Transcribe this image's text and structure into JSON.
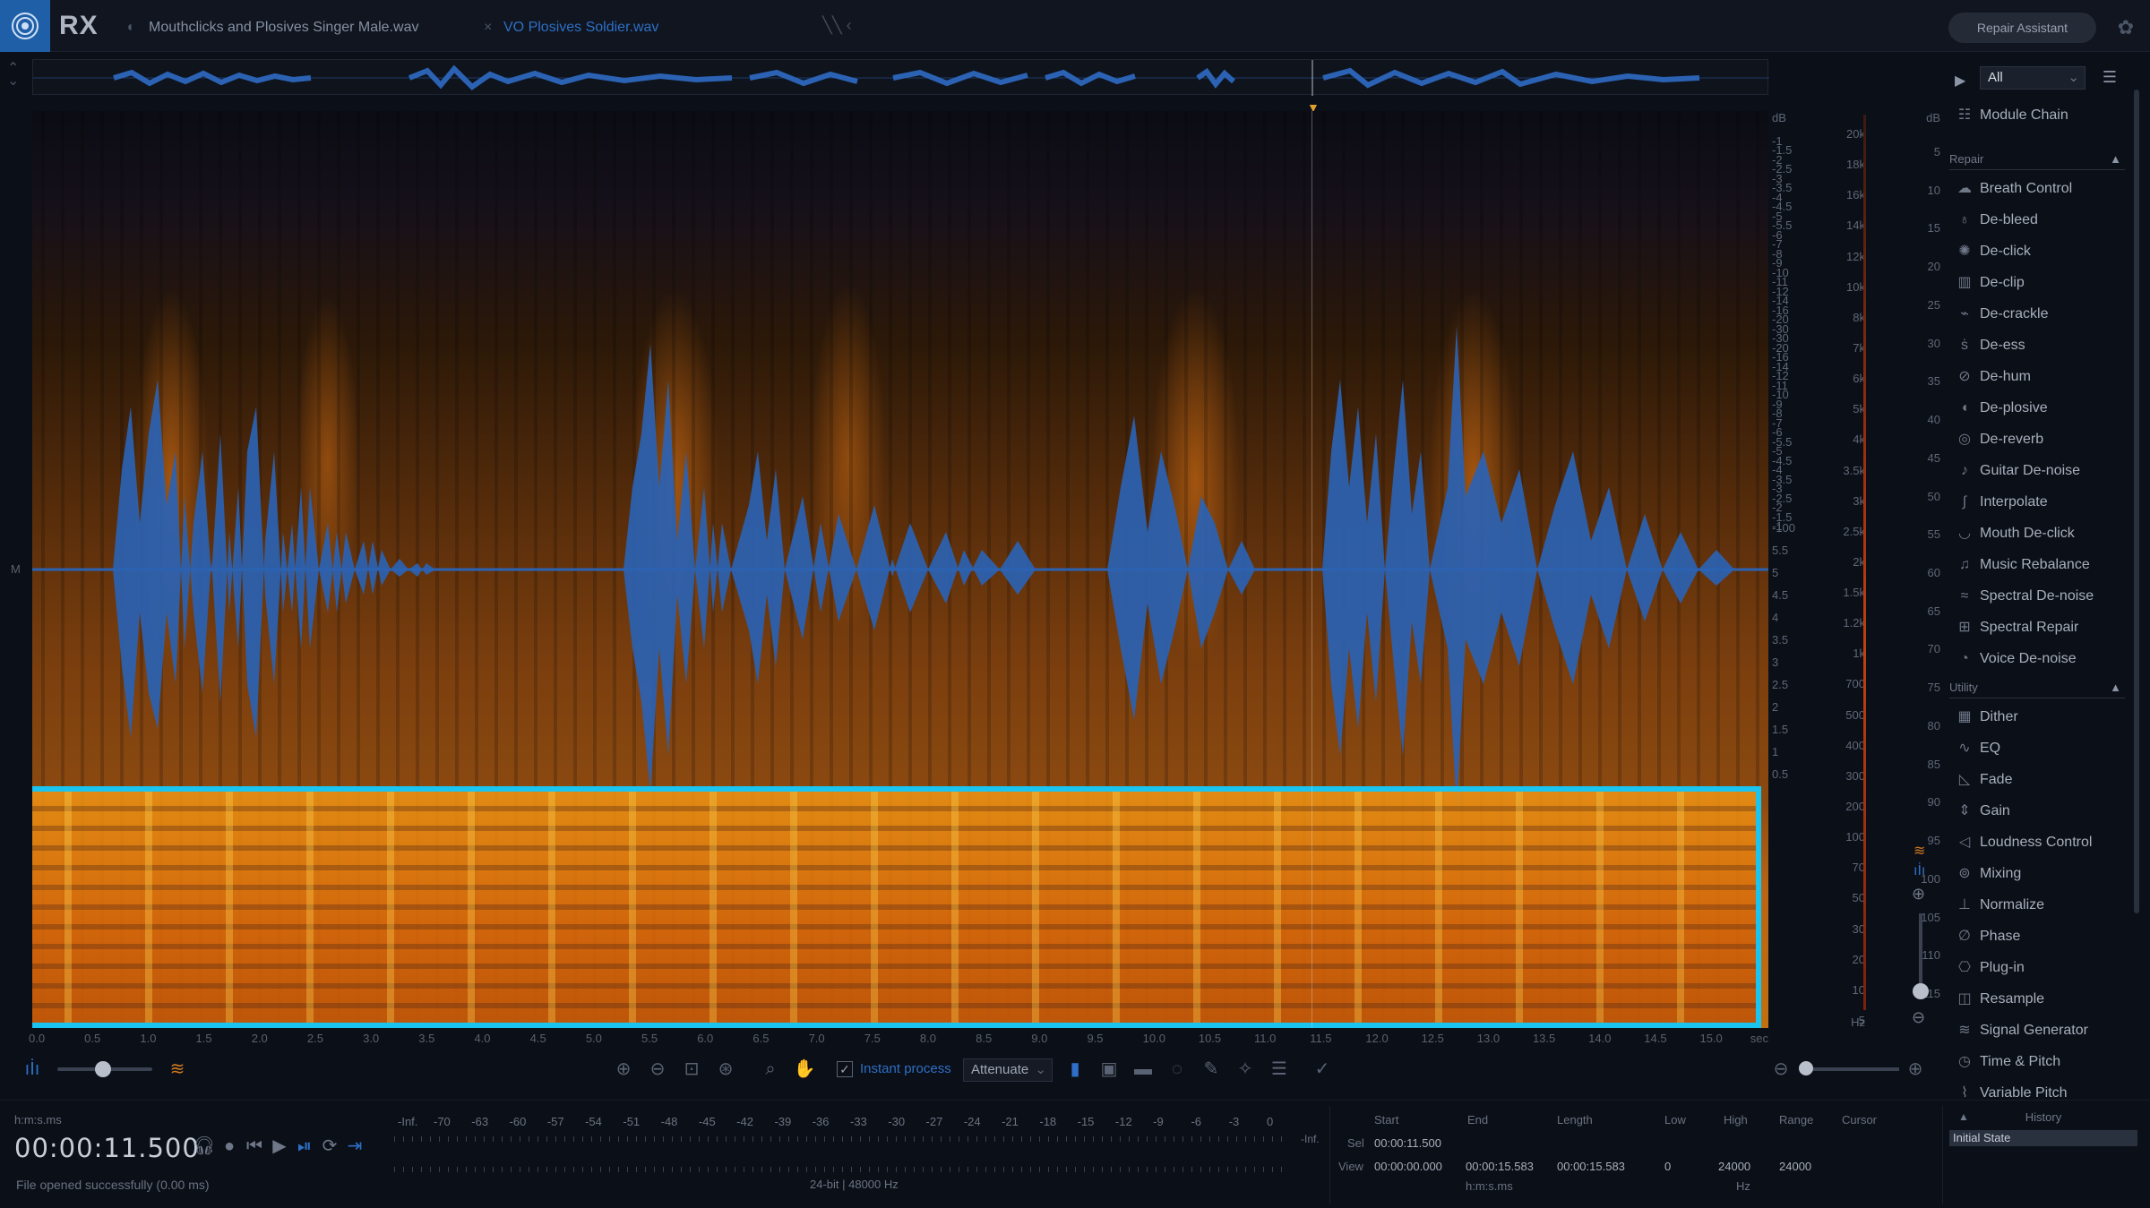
{
  "app": {
    "logo": "RX"
  },
  "tabs": [
    {
      "label": "Mouthclicks and Plosives Singer Male.wav",
      "active": false
    },
    {
      "label": "VO Plosives Soldier.wav",
      "active": true
    }
  ],
  "header": {
    "repair_assistant": "Repair Assistant"
  },
  "channel_label": "M",
  "axes": {
    "db_unit": "dB",
    "db_left": [
      "-1",
      "-1.5",
      "-2",
      "-2.5",
      "-3",
      "-3.5",
      "-4",
      "-4.5",
      "-5",
      "-5.5",
      "-6",
      "-7",
      "-8",
      "-9",
      "-10",
      "-11",
      "-12",
      "-14",
      "-16",
      "-20",
      "-30",
      "-30",
      "-20",
      "-16",
      "-14",
      "-12",
      "-11",
      "-10",
      "-9",
      "-8",
      "-7",
      "-6",
      "-5.5",
      "-5",
      "-4.5",
      "-4",
      "-3.5",
      "-3",
      "-2.5",
      "-2",
      "-1.5",
      "-1"
    ],
    "db_left_lower": [
      "-100",
      "5.5",
      "5",
      "4.5",
      "4",
      "3.5",
      "3",
      "2.5",
      "2",
      "1.5",
      "1",
      "0.5"
    ],
    "hz_ticks": [
      "20k",
      "18k",
      "16k",
      "14k",
      "12k",
      "10k",
      "8k",
      "7k",
      "6k",
      "5k",
      "4k",
      "3.5k",
      "3k",
      "2.5k",
      "2k",
      "1.5k",
      "1.2k",
      "1k",
      "700",
      "500",
      "400",
      "300",
      "200",
      "100",
      "70",
      "50",
      "30",
      "20",
      "10",
      "5"
    ],
    "hz_unit": "Hz",
    "db_right": [
      "5",
      "10",
      "15",
      "20",
      "25",
      "30",
      "35",
      "40",
      "45",
      "50",
      "55",
      "60",
      "65",
      "70",
      "75",
      "80",
      "85",
      "90",
      "95",
      "100",
      "105",
      "110",
      "115"
    ],
    "db_right_unit": "dB",
    "time_ticks": [
      "0.0",
      "0.5",
      "1.0",
      "1.5",
      "2.0",
      "2.5",
      "3.0",
      "3.5",
      "4.0",
      "4.5",
      "5.0",
      "5.5",
      "6.0",
      "6.5",
      "7.0",
      "7.5",
      "8.0",
      "8.5",
      "9.0",
      "9.5",
      "10.0",
      "10.5",
      "11.0",
      "11.5",
      "12.0",
      "12.5",
      "13.0",
      "13.5",
      "14.0",
      "14.5",
      "15.0"
    ],
    "time_unit": "sec"
  },
  "toolbar": {
    "instant_process_label": "Instant process",
    "instant_process_checked": true,
    "mode_select": "Attenuate"
  },
  "module_panel": {
    "filter": "All",
    "module_chain": "Module Chain",
    "sections": [
      {
        "title": "Repair",
        "items": [
          {
            "label": "Breath Control",
            "icon": "breath-icon"
          },
          {
            "label": "De-bleed",
            "icon": "mic-icon"
          },
          {
            "label": "De-click",
            "icon": "click-icon"
          },
          {
            "label": "De-clip",
            "icon": "clip-icon"
          },
          {
            "label": "De-crackle",
            "icon": "crackle-icon"
          },
          {
            "label": "De-ess",
            "icon": "ess-icon"
          },
          {
            "label": "De-hum",
            "icon": "hum-icon"
          },
          {
            "label": "De-plosive",
            "icon": "plosive-icon"
          },
          {
            "label": "De-reverb",
            "icon": "reverb-icon"
          },
          {
            "label": "Guitar De-noise",
            "icon": "guitar-icon"
          },
          {
            "label": "Interpolate",
            "icon": "interpolate-icon"
          },
          {
            "label": "Mouth De-click",
            "icon": "mouth-icon"
          },
          {
            "label": "Music Rebalance",
            "icon": "music-icon"
          },
          {
            "label": "Spectral De-noise",
            "icon": "spectral-denoise-icon"
          },
          {
            "label": "Spectral Repair",
            "icon": "spectral-repair-icon"
          },
          {
            "label": "Voice De-noise",
            "icon": "voice-icon"
          }
        ]
      },
      {
        "title": "Utility",
        "items": [
          {
            "label": "Dither",
            "icon": "dither-icon"
          },
          {
            "label": "EQ",
            "icon": "eq-icon"
          },
          {
            "label": "Fade",
            "icon": "fade-icon"
          },
          {
            "label": "Gain",
            "icon": "gain-icon"
          },
          {
            "label": "Loudness Control",
            "icon": "loudness-icon"
          },
          {
            "label": "Mixing",
            "icon": "mixing-icon"
          },
          {
            "label": "Normalize",
            "icon": "normalize-icon"
          },
          {
            "label": "Phase",
            "icon": "phase-icon"
          },
          {
            "label": "Plug-in",
            "icon": "plugin-icon"
          },
          {
            "label": "Resample",
            "icon": "resample-icon"
          },
          {
            "label": "Signal Generator",
            "icon": "signal-icon"
          },
          {
            "label": "Time & Pitch",
            "icon": "time-pitch-icon"
          },
          {
            "label": "Variable Pitch",
            "icon": "variable-pitch-icon"
          }
        ]
      }
    ]
  },
  "transport": {
    "format": "h:m:s.ms",
    "time": "00:00:11.500",
    "status": "File opened successfully (0.00 ms)"
  },
  "meter": {
    "scale": [
      "-Inf.",
      "-70",
      "-63",
      "-60",
      "-57",
      "-54",
      "-51",
      "-48",
      "-45",
      "-42",
      "-39",
      "-36",
      "-33",
      "-30",
      "-27",
      "-24",
      "-21",
      "-18",
      "-15",
      "-12",
      "-9",
      "-6",
      "-3",
      "0"
    ],
    "inf_label": "-Inf.",
    "format_info": "24-bit | 48000 Hz"
  },
  "selection": {
    "headers": {
      "start": "Start",
      "end": "End",
      "length": "Length",
      "low": "Low",
      "high": "High",
      "range": "Range",
      "cursor": "Cursor"
    },
    "sel_label": "Sel",
    "view_label": "View",
    "sel_start": "00:00:11.500",
    "view_start": "00:00:00.000",
    "view_end": "00:00:15.583",
    "view_length": "00:00:15.583",
    "low": "0",
    "high": "24000",
    "range": "24000",
    "time_unit": "h:m:s.ms",
    "freq_unit": "Hz"
  },
  "history": {
    "title": "History",
    "items": [
      "Initial State"
    ]
  }
}
